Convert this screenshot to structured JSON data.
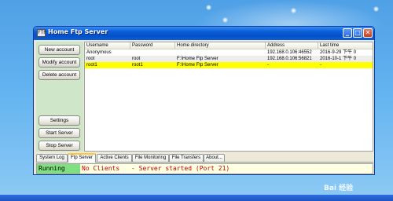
{
  "window": {
    "title": "Home Ftp Server",
    "app_icon_text": "FTP",
    "minimize_glyph": "_",
    "maximize_glyph": "□",
    "close_glyph": "✕"
  },
  "sidebar": {
    "new_account": "New account",
    "modify_account": "Modify account",
    "delete_account": "Delete account",
    "settings": "Settings",
    "start_server": "Start Server",
    "stop_server": "Stop Server"
  },
  "table": {
    "headers": [
      "Username",
      "Password",
      "Home directory",
      "Address",
      "Last time"
    ],
    "rows": [
      {
        "username": "Anonymous",
        "password": "",
        "home": "",
        "address": "192.168.0.106:46552",
        "last": "2016-9-29 下午 0"
      },
      {
        "username": "root",
        "password": "root",
        "home": "F:\\Home Ftp Server",
        "address": "192.168.0.106:56821",
        "last": "2016-10-1 下午 0"
      },
      {
        "username": "root1",
        "password": "root1",
        "home": "F:\\Home Ftp Server",
        "address": "-",
        "last": "-"
      }
    ]
  },
  "tabs": [
    "System Log",
    "Ftp Server",
    "Active Clients",
    "File Monitoring",
    "File Transfers",
    "About..."
  ],
  "active_tab": "Ftp Server",
  "status": {
    "state": "Running",
    "clients": "No Clients",
    "message": "- Server started (Port 21)"
  },
  "watermark": "Bai 经验",
  "colors": {
    "titlebar": "#0a5fd8",
    "selected_row": "#ffff00",
    "running": "#7ee07e",
    "status_text": "#c00000"
  }
}
